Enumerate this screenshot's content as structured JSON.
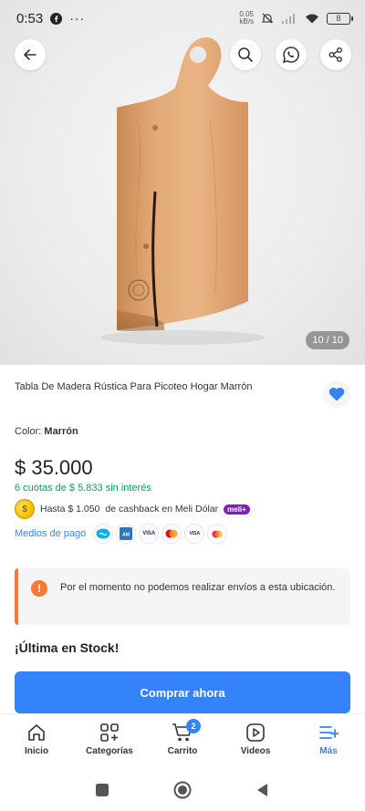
{
  "status": {
    "time": "0:53",
    "net_speed_top": "0.05",
    "net_speed_bottom": "kB/s",
    "battery": "8",
    "icons": [
      "facebook-icon",
      "more-notifications-icon",
      "mute-icon",
      "signal-icon",
      "wifi-icon",
      "battery-icon"
    ]
  },
  "hero": {
    "counter": "10 / 10",
    "buttons": [
      "back-icon",
      "search-icon",
      "whatsapp-icon",
      "share-icon"
    ]
  },
  "product": {
    "title": "Tabla De Madera Rústica Para Picoteo Hogar Marrón",
    "color_label": "Color:",
    "color_value": "Marrón",
    "price": "$ 35.000",
    "installments": "6 cuotas de $ 5.833 sin interés",
    "cashback_amount": "Hasta $ 1.050",
    "cashback_text": "de cashback en Meli Dólar",
    "meli_badge": "meli+",
    "payment_methods_label": "Medios de pago",
    "payment_icons": [
      "mercadopago",
      "amex",
      "VISA",
      "mastercard",
      "VISA",
      "mastercard"
    ]
  },
  "notice": {
    "text": "Por el momento no podemos realizar envíos a esta ubicación."
  },
  "stock_text": "¡Última en Stock!",
  "buy_button": "Comprar ahora",
  "bottom_nav": {
    "items": [
      {
        "label": "Inicio",
        "icon": "home-icon"
      },
      {
        "label": "Categorías",
        "icon": "categories-icon"
      },
      {
        "label": "Carrito",
        "icon": "cart-icon",
        "badge": "2"
      },
      {
        "label": "Videos",
        "icon": "video-icon"
      },
      {
        "label": "Más",
        "icon": "menu-plus-icon",
        "active": true
      }
    ]
  },
  "colors": {
    "accent": "#3483fa",
    "success": "#00a650",
    "warning": "#ff7733"
  }
}
